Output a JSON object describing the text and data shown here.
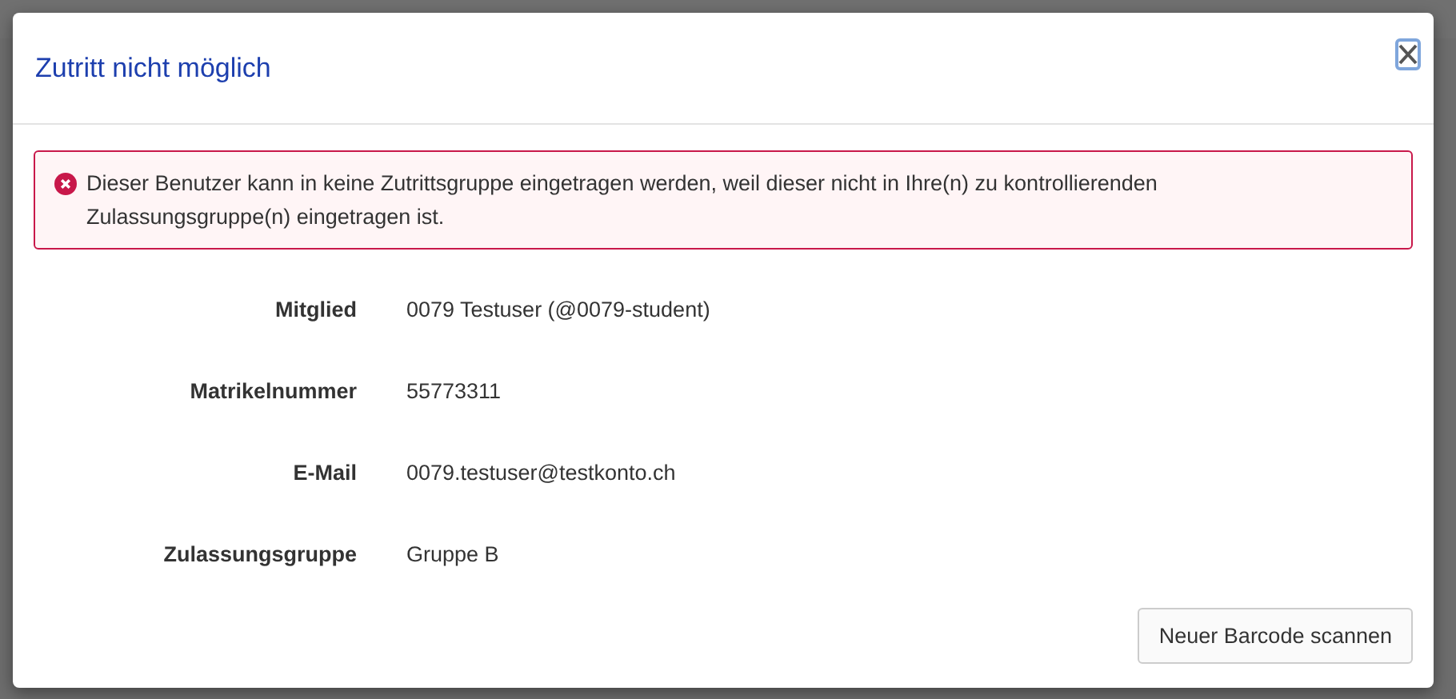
{
  "dialog": {
    "title": "Zutritt nicht möglich",
    "alert": {
      "kind": "error",
      "text": "Dieser Benutzer kann in keine Zutrittsgruppe eingetragen werden, weil dieser nicht in Ihre(n) zu kontrollierenden Zulassungsgruppe(n) eingetragen ist."
    },
    "fields": [
      {
        "label": "Mitglied",
        "value": "0079 Testuser (@0079-student)"
      },
      {
        "label": "Matrikelnummer",
        "value": "55773311"
      },
      {
        "label": "E-Mail",
        "value": "0079.testuser@testkonto.ch"
      },
      {
        "label": "Zulassungsgruppe",
        "value": "Gruppe B"
      }
    ],
    "button": "Neuer Barcode scannen"
  }
}
